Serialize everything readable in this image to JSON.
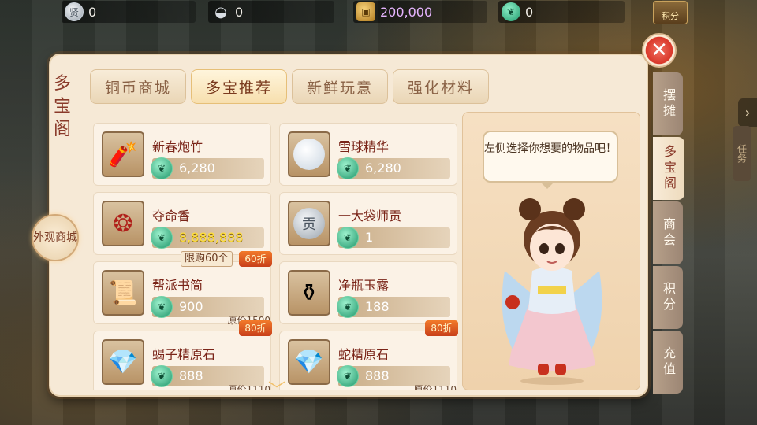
{
  "currencies": [
    {
      "icon": "silver-coin-icon",
      "glyph": "贤",
      "value": "0"
    },
    {
      "icon": "silver-ingot-icon",
      "glyph": "◒",
      "value": "0"
    },
    {
      "icon": "copper-coin-icon",
      "glyph": "▣",
      "value": "200,000"
    },
    {
      "icon": "jade-icon",
      "glyph": "❦",
      "value": "0"
    }
  ],
  "score_button": "积分",
  "panel_title": "多宝阁",
  "tabs": [
    {
      "label": "铜币商城",
      "active": false
    },
    {
      "label": "多宝推荐",
      "active": true
    },
    {
      "label": "新鲜玩意",
      "active": false
    },
    {
      "label": "强化材料",
      "active": false
    }
  ],
  "items": [
    {
      "name": "新春炮竹",
      "price": "6,280",
      "icon": "firecracker-icon",
      "glyph": "🧨"
    },
    {
      "name": "雪球精华",
      "price": "6,280",
      "icon": "snowball-icon",
      "glyph": "⚪"
    },
    {
      "name": "夺命香",
      "price": "8,888,888",
      "icon": "incense-icon",
      "glyph": "❂",
      "highlight": true
    },
    {
      "name": "一大袋师贡",
      "price": "1",
      "icon": "tribute-bag-icon",
      "glyph": "贡"
    },
    {
      "name": "帮派书简",
      "price": "900",
      "icon": "scroll-icon",
      "glyph": "📜",
      "limit": "限购60个",
      "discount": "60折",
      "original": "原价1500"
    },
    {
      "name": "净瓶玉露",
      "price": "188",
      "icon": "jade-vase-icon",
      "glyph": "⚱"
    },
    {
      "name": "蝎子精原石",
      "price": "888",
      "icon": "scorpion-stone-icon",
      "glyph": "💎",
      "discount": "80折",
      "original": "原价1110"
    },
    {
      "name": "蛇精原石",
      "price": "888",
      "icon": "snake-stone-icon",
      "glyph": "💎",
      "discount": "80折",
      "original": "原价1110"
    }
  ],
  "bubble_text": "左侧选择你想要的物品吧！",
  "side_tabs": [
    {
      "label": "摆摊",
      "active": false
    },
    {
      "label": "多宝阁",
      "active": true
    },
    {
      "label": "商会",
      "active": false
    },
    {
      "label": "积分",
      "active": false
    },
    {
      "label": "充值",
      "active": false
    }
  ],
  "outer_shop_button": "外观商城",
  "task_tag": "任务"
}
